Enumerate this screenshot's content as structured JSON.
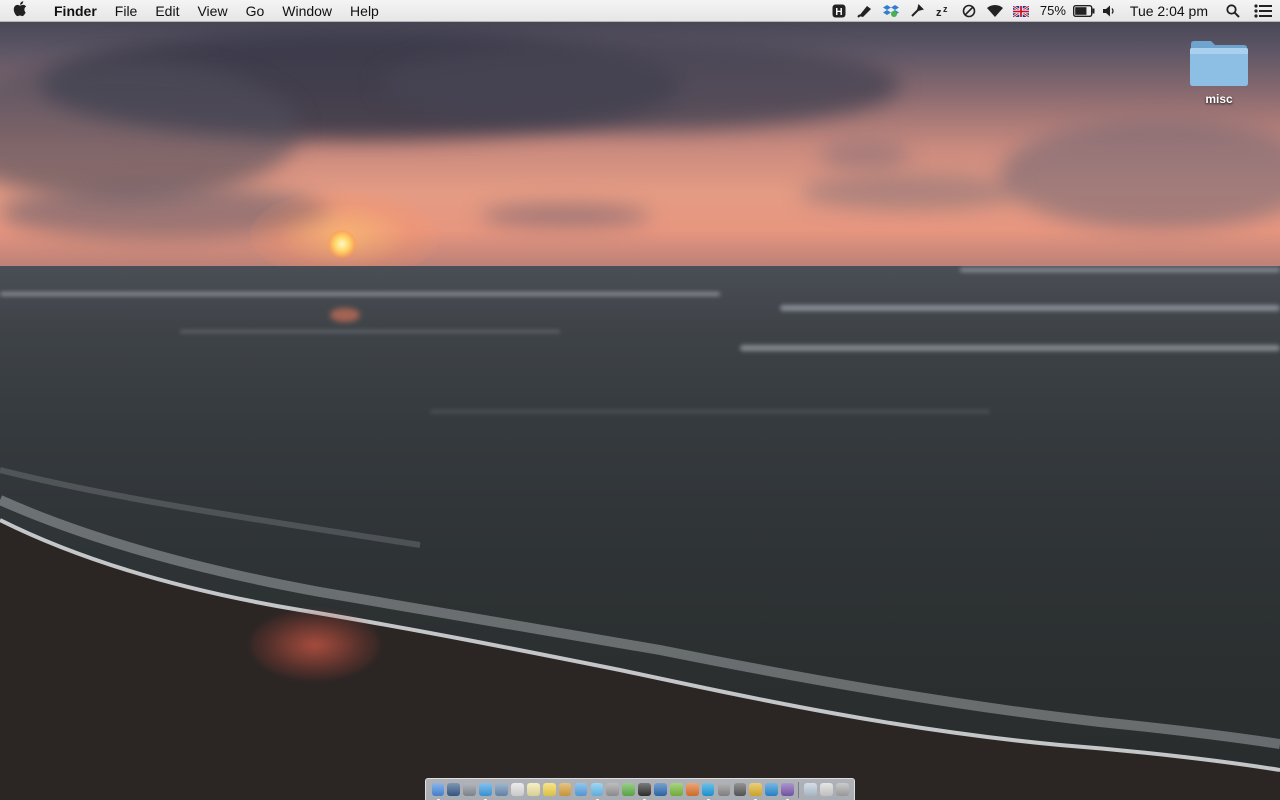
{
  "menubar": {
    "app_name": "Finder",
    "menus": [
      "File",
      "Edit",
      "View",
      "Go",
      "Window",
      "Help"
    ],
    "status_icons": [
      {
        "name": "hammerspoon-icon",
        "glyph": "H"
      },
      {
        "name": "pen-tablet-icon",
        "glyph": "✎"
      },
      {
        "name": "dropbox-icon",
        "glyph": "❖"
      },
      {
        "name": "tool-icon",
        "glyph": "✂"
      },
      {
        "name": "sleep-zz-icon",
        "glyph": "zᶻ"
      },
      {
        "name": "do-not-disturb-icon",
        "glyph": "⊘"
      },
      {
        "name": "wifi-icon",
        "glyph": "◠"
      },
      {
        "name": "uk-flag-icon",
        "glyph": "▦"
      }
    ],
    "battery_percent": "75%",
    "battery_level": 0.75,
    "clock": "Tue 2:04 pm"
  },
  "desktop": {
    "icons": [
      {
        "label": "misc",
        "type": "folder"
      }
    ]
  },
  "dock": {
    "apps": [
      {
        "name": "finder",
        "color": "#4b8de0",
        "running": true
      },
      {
        "name": "dashboard",
        "color": "#3a5e8c",
        "running": false
      },
      {
        "name": "launchpad",
        "color": "#8a8f99",
        "running": false
      },
      {
        "name": "safari",
        "color": "#3ea0e6",
        "running": true
      },
      {
        "name": "mail",
        "color": "#6d8fb5",
        "running": false
      },
      {
        "name": "calendar",
        "color": "#e0e0e0",
        "running": false
      },
      {
        "name": "notes",
        "color": "#f1e7a4",
        "running": false
      },
      {
        "name": "stickies",
        "color": "#f4d54c",
        "running": false
      },
      {
        "name": "preview",
        "color": "#d9a441",
        "running": false
      },
      {
        "name": "app-store",
        "color": "#5aa7e8",
        "running": false
      },
      {
        "name": "messages",
        "color": "#6cc0f0",
        "running": true
      },
      {
        "name": "photo-booth",
        "color": "#9a9a9a",
        "running": false
      },
      {
        "name": "evernote",
        "color": "#62b44a",
        "running": false
      },
      {
        "name": "terminal-app",
        "color": "#333333",
        "running": true
      },
      {
        "name": "onepassword",
        "color": "#2f6fb3",
        "running": false
      },
      {
        "name": "evernote-clipper",
        "color": "#7bbd3d",
        "running": false
      },
      {
        "name": "sublime",
        "color": "#e2762f",
        "running": false
      },
      {
        "name": "skype",
        "color": "#1ea0e0",
        "running": true
      },
      {
        "name": "utility",
        "color": "#8c8c8c",
        "running": false
      },
      {
        "name": "keynote",
        "color": "#5b5b5b",
        "running": false
      },
      {
        "name": "chrome",
        "color": "#e0b530",
        "running": true
      },
      {
        "name": "vpn",
        "color": "#2b8fd6",
        "running": false
      },
      {
        "name": "viber",
        "color": "#7f5bb3",
        "running": true
      }
    ],
    "stacks": [
      {
        "name": "applications-stack",
        "color": "#b8c8d8"
      },
      {
        "name": "documents-stack",
        "color": "#d4d4d4"
      },
      {
        "name": "trash",
        "color": "#a8a8a8"
      }
    ]
  }
}
